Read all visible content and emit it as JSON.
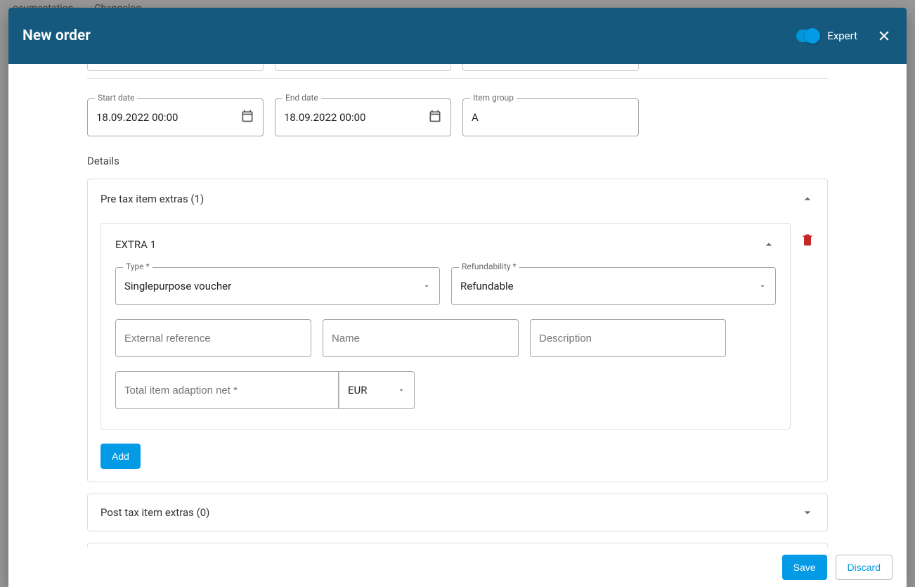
{
  "bg_nav": {
    "doc": "ocumentation",
    "changelog": "Changelog"
  },
  "modal": {
    "title": "New order",
    "expert_label": "Expert",
    "expert_on": true
  },
  "fields": {
    "start_date": {
      "label": "Start date",
      "value": "18.09.2022 00:00"
    },
    "end_date": {
      "label": "End date",
      "value": "18.09.2022 00:00"
    },
    "item_group": {
      "label": "Item group",
      "value": "A"
    }
  },
  "details_label": "Details",
  "pretax": {
    "title": "Pre tax item extras (1)",
    "extra": {
      "title": "EXTRA 1",
      "type_label": "Type *",
      "type_value": "Singlepurpose voucher",
      "refund_label": "Refundability *",
      "refund_value": "Refundable",
      "ext_ref_placeholder": "External reference",
      "name_placeholder": "Name",
      "desc_placeholder": "Description",
      "net_placeholder": "Total item adaption net *",
      "currency": "EUR"
    },
    "add_label": "Add"
  },
  "posttax": {
    "title": "Post tax item extras (0)"
  },
  "footer": {
    "save": "Save",
    "discard": "Discard"
  }
}
